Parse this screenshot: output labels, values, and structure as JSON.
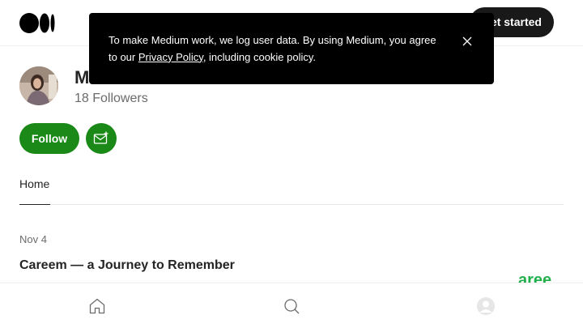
{
  "header": {
    "logo_icon": "medium-logo-icon",
    "get_started_label": "Get started"
  },
  "cookie_banner": {
    "text_before": "To make Medium work, we log user data. By using Medium, you agree to our ",
    "link_label": "Privacy Policy",
    "text_after": ", including cookie policy.",
    "close_icon": "close-icon"
  },
  "profile": {
    "name": "M",
    "followers": "18 Followers",
    "follow_label": "Follow",
    "subscribe_icon": "mail-plus-icon"
  },
  "tabs": [
    {
      "label": "Home",
      "active": true
    }
  ],
  "post": {
    "date": "Nov 4",
    "title": "Careem — a Journey to Remember",
    "thumb_text": "aree"
  },
  "bottom_nav": {
    "icons": [
      "home-icon",
      "search-icon",
      "profile-icon"
    ]
  },
  "colors": {
    "accent": "#1a8917",
    "dark": "#191919",
    "text": "#242424",
    "muted": "#6b6b6b"
  }
}
